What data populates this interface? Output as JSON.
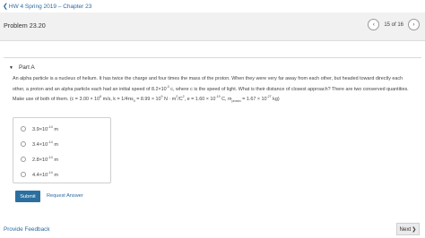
{
  "breadcrumb": {
    "label": "HW 4 Spring 2019 – Chapter 23"
  },
  "header": {
    "title": "Problem 23.20",
    "pager_text": "15 of 16"
  },
  "part": {
    "label": "Part A"
  },
  "question": {
    "t1": "An alpha particle is a nucleus of helium. It has twice the charge and four times the mass of the proton. When they were very far away from each other, but headed toward directly each other, a proton and",
    "t2": "an alpha particle each had an initial speed of 8.2×10",
    "t2_sup": "-3",
    "t3": " c, where c is the speed of light. What is their distance of closest approach? There are two conserved quantities. Make use of both of them. (c = 3.00",
    "t4": "× 10",
    "t4_sup": "8",
    "t5": " m/s, k = 1/4πε",
    "t5_sub": "0",
    "t6": " = 8.99 × 10",
    "t6_sup": "9",
    "t7": " N · m",
    "t7_sup": "2",
    "t8": "/C",
    "t8_sup": "2",
    "t9": ", e = 1.60 × 10",
    "t9_sup": "-19",
    "t10": " C, m",
    "t10_sub": "proton",
    "t11": " = 1.67 × 10",
    "t11_sup": "-27",
    "t12": " kg)"
  },
  "choices": [
    {
      "base": "3.9×10",
      "exp": "-14",
      "unit": " m"
    },
    {
      "base": "3.4×10",
      "exp": "-14",
      "unit": " m"
    },
    {
      "base": "2.8×10",
      "exp": "-14",
      "unit": " m"
    },
    {
      "base": "4.4×10",
      "exp": "-14",
      "unit": " m"
    }
  ],
  "actions": {
    "submit": "Submit",
    "request": "Request Answer"
  },
  "footer": {
    "feedback": "Provide Feedback",
    "next": "Next"
  },
  "icons": {
    "back": "chevron-left-icon",
    "prev": "chevron-left-icon",
    "next": "chevron-right-icon",
    "collapse": "triangle-down-icon"
  },
  "colors": {
    "link": "#2a6aa3",
    "submit_bg": "#2b6f9f"
  }
}
